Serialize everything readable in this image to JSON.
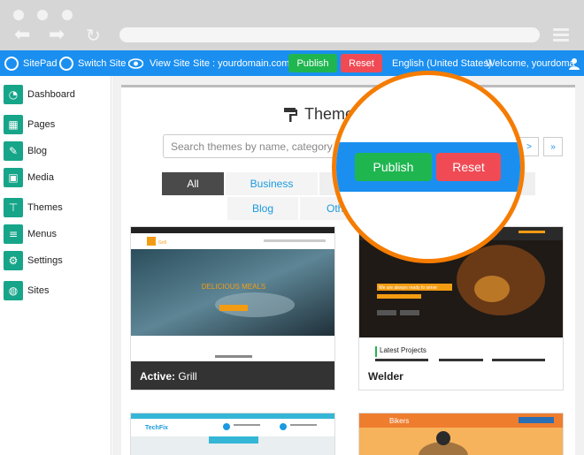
{
  "topbar": {
    "brand": "SitePad",
    "switch_site": "Switch Site",
    "view_site": "View Site",
    "site": "Site : yourdomain.com",
    "publish": "Publish",
    "reset": "Reset",
    "language": "English (United States)",
    "welcome": "Welcome, yourdoma"
  },
  "sidebar": {
    "items": [
      {
        "label": "Dashboard",
        "icon": "dashboard-icon"
      },
      {
        "label": "Pages",
        "icon": "pages-icon"
      },
      {
        "label": "Blog",
        "icon": "blog-icon"
      },
      {
        "label": "Media",
        "icon": "media-icon"
      },
      {
        "label": "Themes",
        "icon": "paint-roller-icon"
      },
      {
        "label": "Menus",
        "icon": "menus-icon"
      },
      {
        "label": "Settings",
        "icon": "gear-icon"
      },
      {
        "label": "Sites",
        "icon": "globe-icon"
      }
    ]
  },
  "main": {
    "title": "Themes",
    "search_placeholder": "Search themes by name, category or",
    "pager_next": ">",
    "pager_last": "»",
    "tabs": [
      "All",
      "Business",
      "Blog",
      "Other"
    ],
    "themes": [
      {
        "name": "Grill",
        "active_prefix": "Active:",
        "hero": "DELICIOUS MEALS"
      },
      {
        "name": "Welder",
        "banner": "We are always ready to serve",
        "section": "Latest Projects"
      },
      {
        "name": "TechFix"
      },
      {
        "name": "Bikers"
      }
    ]
  },
  "zoom": {
    "publish": "Publish",
    "reset": "Reset"
  },
  "colors": {
    "topbar": "#1a8ff0",
    "publish": "#1fb650",
    "reset": "#f04b55",
    "sidebar_icon": "#17a589",
    "zoom_ring": "#f57c00"
  }
}
